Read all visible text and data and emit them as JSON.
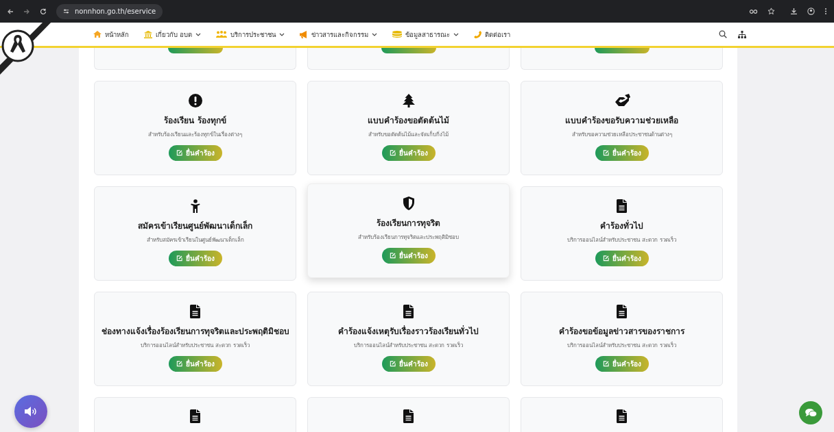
{
  "browser": {
    "url": "nonnhon.go.th/eservice"
  },
  "nav": {
    "items": [
      {
        "label": "หน้าหลัก",
        "dropdown": false
      },
      {
        "label": "เกี่ยวกับ อบต",
        "dropdown": true
      },
      {
        "label": "บริการประชาชน",
        "dropdown": true
      },
      {
        "label": "ข่าวสารและกิจกรรม",
        "dropdown": true
      },
      {
        "label": "ข้อมูลสาธารณะ",
        "dropdown": true
      },
      {
        "label": "ติดต่อเรา",
        "dropdown": false
      }
    ]
  },
  "top_partial_cards": [
    {
      "kind": "button_edge"
    },
    {
      "kind": "button_edge"
    },
    {
      "kind": "button_edge"
    }
  ],
  "services": [
    {
      "title": "ร้องเรียน ร้องทุกข์",
      "description": "สำหรับร้องเรียนและร้องทุกข์ในเรื่องต่างๆ",
      "button": "ยื่นคำร้อง",
      "highlighted": false
    },
    {
      "title": "แบบคำร้องขอตัดต้นไม้",
      "description": "สำหรับขอตัดต้นไม้และจัดเก็บกิ่งไม้",
      "button": "ยื่นคำร้อง",
      "highlighted": false
    },
    {
      "title": "แบบคำร้องขอรับความช่วยเหลือ",
      "description": "สำหรับขอความช่วยเหลือประชาชนด้านต่างๆ",
      "button": "ยื่นคำร้อง",
      "highlighted": false
    },
    {
      "title": "สมัครเข้าเรียนศูนย์พัฒนาเด็กเล็ก",
      "description": "สำหรับสมัครเข้าเรียนในศูนย์พัฒนาเด็กเล็ก",
      "button": "ยื่นคำร้อง",
      "highlighted": false
    },
    {
      "title": "ร้องเรียนการทุจริต",
      "description": "สำหรับร้องเรียนการทุจริตและประพฤติมิชอบ",
      "button": "ยื่นคำร้อง",
      "highlighted": true
    },
    {
      "title": "คำร้องทั่วไป",
      "description": "บริการออนไลน์สำหรับประชาชน สะดวก รวดเร็ว",
      "button": "ยื่นคำร้อง",
      "highlighted": false
    },
    {
      "title": "ช่องทางแจ้งเรื่องร้องเรียนการทุจริตและประพฤติมิชอบ",
      "description": "บริการออนไลน์สำหรับประชาชน สะดวก รวดเร็ว",
      "button": "ยื่นคำร้อง",
      "highlighted": false
    },
    {
      "title": "คำร้องแจ้งเหตุรับเรื่องราวร้องเรียนทั่วไป",
      "description": "บริการออนไลน์สำหรับประชาชน สะดวก รวดเร็ว",
      "button": "ยื่นคำร้อง",
      "highlighted": false
    },
    {
      "title": "คำร้องขอข้อมูลข่าวสารของราชการ",
      "description": "บริการออนไลน์สำหรับประชาชน สะดวก รวดเร็ว",
      "button": "ยื่นคำร้อง",
      "highlighted": false
    }
  ],
  "bottom_partial_cards": [
    {
      "kind": "cut_off"
    },
    {
      "kind": "cut_off"
    },
    {
      "kind": "cut_off"
    }
  ]
}
